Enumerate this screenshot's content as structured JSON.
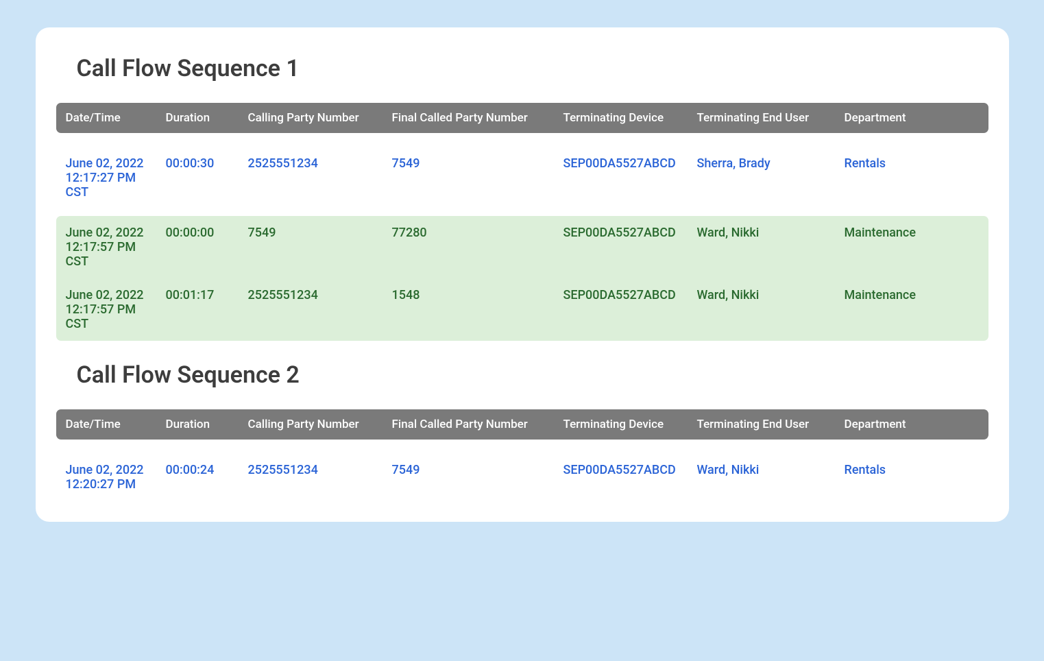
{
  "sequences": [
    {
      "title": "Call Flow Sequence 1",
      "columns": [
        "Date/Time",
        "Duration",
        "Calling Party Number",
        "Final Called Party Number",
        "Terminating Device",
        "Terminating End User",
        "Department"
      ],
      "groups": [
        {
          "style": "blue",
          "rows": [
            {
              "datetime": "June 02, 2022 12:17:27 PM CST",
              "duration": "00:00:30",
              "calling": "2525551234",
              "finalcalled": "7549",
              "device": "SEP00DA5527ABCD",
              "enduser": "Sherra, Brady",
              "department": "Rentals"
            }
          ]
        },
        {
          "style": "green",
          "rows": [
            {
              "datetime": "June 02, 2022 12:17:57 PM CST",
              "duration": "00:00:00",
              "calling": "7549",
              "finalcalled": "77280",
              "device": "SEP00DA5527ABCD",
              "enduser": "Ward, Nikki",
              "department": "Maintenance"
            },
            {
              "datetime": "June 02, 2022 12:17:57 PM CST",
              "duration": "00:01:17",
              "calling": "2525551234",
              "finalcalled": "1548",
              "device": "SEP00DA5527ABCD",
              "enduser": "Ward, Nikki",
              "department": "Maintenance"
            }
          ]
        }
      ]
    },
    {
      "title": "Call Flow Sequence 2",
      "columns": [
        "Date/Time",
        "Duration",
        "Calling Party Number",
        "Final Called Party Number",
        "Terminating Device",
        "Terminating End User",
        "Department"
      ],
      "groups": [
        {
          "style": "blue",
          "rows": [
            {
              "datetime": "June 02, 2022 12:20:27 PM",
              "duration": "00:00:24",
              "calling": "2525551234",
              "finalcalled": "7549",
              "device": "SEP00DA5527ABCD",
              "enduser": "Ward, Nikki",
              "department": "Rentals"
            }
          ]
        }
      ]
    }
  ]
}
